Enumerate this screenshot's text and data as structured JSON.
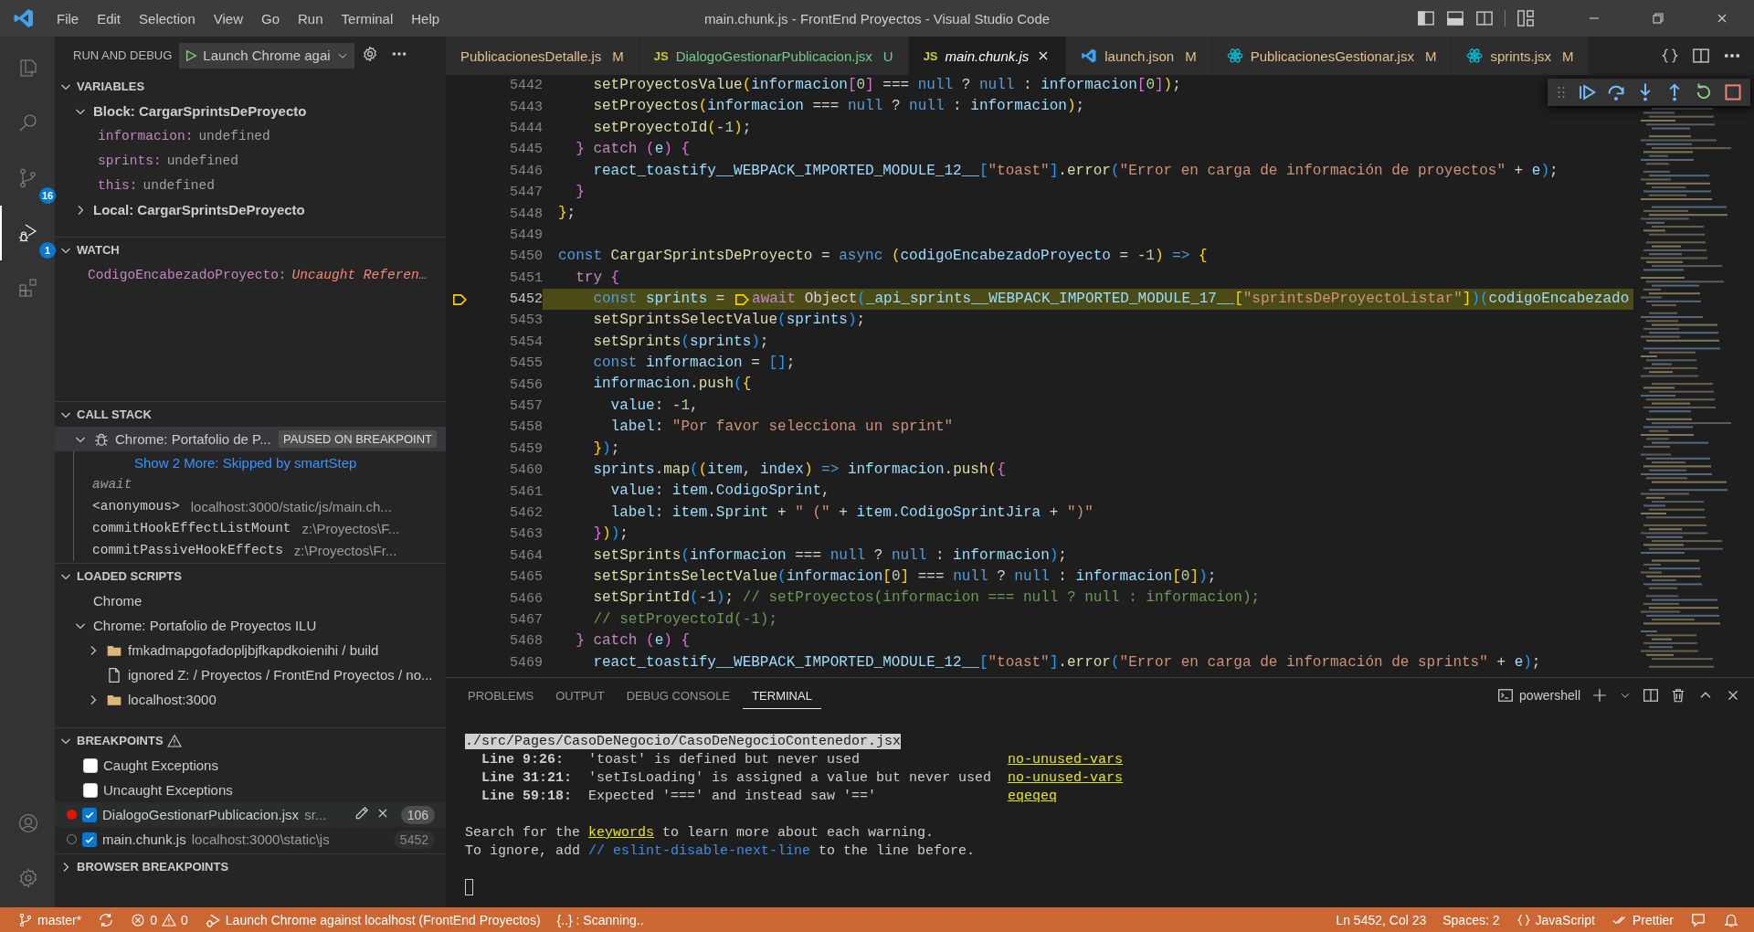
{
  "title_bar": {
    "menu": [
      "File",
      "Edit",
      "Selection",
      "View",
      "Go",
      "Run",
      "Terminal",
      "Help"
    ],
    "title": "main.chunk.js - FrontEnd Proyectos - Visual Studio Code"
  },
  "activity_bar": {
    "items": [
      {
        "kind": "explorer",
        "selected": false
      },
      {
        "kind": "search",
        "selected": false
      },
      {
        "kind": "source-control",
        "selected": false,
        "badge": "16"
      },
      {
        "kind": "run-debug",
        "selected": true,
        "badge": "1"
      },
      {
        "kind": "extensions",
        "selected": false
      }
    ],
    "bottom": [
      {
        "kind": "accounts"
      },
      {
        "kind": "manage"
      }
    ]
  },
  "sidebar": {
    "title": "RUN AND DEBUG",
    "launch_config": "Launch Chrome agai",
    "variables": {
      "title": "VARIABLES",
      "expanded": true,
      "scopes": [
        {
          "label": "Block: CargarSprintsDeProyecto",
          "expanded": true,
          "children": [
            {
              "name": "informacion:",
              "value": "undefined"
            },
            {
              "name": "sprints:",
              "value": "undefined"
            },
            {
              "name": "this:",
              "value": "undefined"
            }
          ]
        },
        {
          "label": "Local: CargarSprintsDeProyecto",
          "expanded": false
        }
      ]
    },
    "watch": {
      "title": "WATCH",
      "expanded": true,
      "items": [
        {
          "expression": "CodigoEncabezadoProyecto:",
          "value": "Uncaught Referen…"
        }
      ]
    },
    "call_stack": {
      "title": "CALL STACK",
      "expanded": true,
      "session": {
        "label": "Chrome: Portafolio de P...",
        "status": "PAUSED ON BREAKPOINT",
        "expanded": true
      },
      "show_more": "Show 2 More: Skipped by smartStep",
      "frames": [
        {
          "kind": "label",
          "name": "await"
        },
        {
          "kind": "frame",
          "name": "<anonymous>",
          "source": "localhost:3000/static/js/main.ch..."
        },
        {
          "kind": "frame",
          "name": "commitHookEffectListMount",
          "source": "z:\\Proyectos\\F..."
        },
        {
          "kind": "frame",
          "name": "commitPassiveHookEffects",
          "source": "z:\\Proyectos\\Fr..."
        }
      ]
    },
    "loaded_scripts": {
      "title": "LOADED SCRIPTS",
      "expanded": true,
      "items": [
        {
          "label": "Chrome"
        },
        {
          "label": "Chrome: Portafolio de Proyectos ILU",
          "expanded": true,
          "children": [
            {
              "kind": "folder",
              "label": "fmkadmapgofadopljbjfkapdkoienihi / build",
              "expanded": false
            },
            {
              "kind": "file",
              "label": "ignored Z: / Proyectos / FrontEnd Proyectos / no..."
            },
            {
              "kind": "folder",
              "label": "localhost:3000",
              "expanded": false
            }
          ]
        }
      ]
    },
    "breakpoints": {
      "title": "BREAKPOINTS",
      "warning": true,
      "expanded": true,
      "items": [
        {
          "kind": "exception",
          "label": "Caught Exceptions",
          "checked": false
        },
        {
          "kind": "exception",
          "label": "Uncaught Exceptions",
          "checked": false
        },
        {
          "kind": "source",
          "label": "DialogoGestionarPublicacion.jsx",
          "path": "sr...",
          "line": "106",
          "checked": true,
          "verified": true,
          "selected": true
        },
        {
          "kind": "source",
          "label": "main.chunk.js",
          "path": "localhost:3000\\static\\js",
          "line": "5452",
          "checked": true,
          "verified": false,
          "selected": false
        }
      ]
    },
    "browser_breakpoints": {
      "title": "BROWSER BREAKPOINTS",
      "expanded": false
    }
  },
  "editor": {
    "tabs": [
      {
        "kind": "plain",
        "label": "PublicacionesDetalle.js",
        "status": "M",
        "selected": false,
        "preview": false
      },
      {
        "kind": "js",
        "badge": "JS",
        "label": "DialogoGestionarPublicacion.jsx",
        "status": "U",
        "selected": false,
        "preview": false
      },
      {
        "kind": "js",
        "badge": "JS",
        "label": "main.chunk.js",
        "selected": true,
        "preview": true
      },
      {
        "kind": "vscode",
        "label": "launch.json",
        "status": "M",
        "selected": false,
        "preview": false
      },
      {
        "kind": "react",
        "label": "PublicacionesGestionar.jsx",
        "status": "M",
        "selected": false,
        "preview": false
      },
      {
        "kind": "react",
        "label": "sprints.jsx",
        "status": "M",
        "selected": false,
        "preview": false
      }
    ],
    "lines": [
      {
        "number": "5442",
        "current": false,
        "tokens": [
          {
            "kind": "fn",
            "text": "    setProyectosValue"
          },
          {
            "kind": "b1",
            "text": "("
          },
          {
            "kind": "var",
            "text": "informacion"
          },
          {
            "kind": "b2",
            "text": "["
          },
          {
            "kind": "num",
            "text": "0"
          },
          {
            "kind": "b2",
            "text": "]"
          },
          {
            "kind": "p",
            "text": " === "
          },
          {
            "kind": "kw",
            "text": "null"
          },
          {
            "kind": "p",
            "text": " ? "
          },
          {
            "kind": "kw",
            "text": "null"
          },
          {
            "kind": "p",
            "text": " : "
          },
          {
            "kind": "var",
            "text": "informacion"
          },
          {
            "kind": "b2",
            "text": "["
          },
          {
            "kind": "num",
            "text": "0"
          },
          {
            "kind": "b2",
            "text": "]"
          },
          {
            "kind": "b1",
            "text": ")"
          },
          {
            "kind": "p",
            "text": ";"
          }
        ]
      },
      {
        "number": "5443",
        "current": false,
        "tokens": [
          {
            "kind": "fn",
            "text": "    setProyectos"
          },
          {
            "kind": "b1",
            "text": "("
          },
          {
            "kind": "var",
            "text": "informacion"
          },
          {
            "kind": "p",
            "text": " === "
          },
          {
            "kind": "kw",
            "text": "null"
          },
          {
            "kind": "p",
            "text": " ? "
          },
          {
            "kind": "kw",
            "text": "null"
          },
          {
            "kind": "p",
            "text": " : "
          },
          {
            "kind": "var",
            "text": "informacion"
          },
          {
            "kind": "b1",
            "text": ")"
          },
          {
            "kind": "p",
            "text": ";"
          }
        ]
      },
      {
        "number": "5444",
        "current": false,
        "tokens": [
          {
            "kind": "fn",
            "text": "    setProyectoId"
          },
          {
            "kind": "b1",
            "text": "("
          },
          {
            "kind": "p",
            "text": "-"
          },
          {
            "kind": "num",
            "text": "1"
          },
          {
            "kind": "b1",
            "text": ")"
          },
          {
            "kind": "p",
            "text": ";"
          }
        ]
      },
      {
        "number": "5445",
        "current": false,
        "tokens": [
          {
            "kind": "b2",
            "text": "  }"
          },
          {
            "kind": "ctl",
            "text": " catch "
          },
          {
            "kind": "b2",
            "text": "("
          },
          {
            "kind": "var",
            "text": "e"
          },
          {
            "kind": "b2",
            "text": ") {"
          }
        ]
      },
      {
        "number": "5446",
        "current": false,
        "tokens": [
          {
            "kind": "var",
            "text": "    react_toastify__WEBPACK_IMPORTED_MODULE_12__"
          },
          {
            "kind": "b3",
            "text": "["
          },
          {
            "kind": "str",
            "text": "\"toast\""
          },
          {
            "kind": "b3",
            "text": "]"
          },
          {
            "kind": "p",
            "text": "."
          },
          {
            "kind": "fn",
            "text": "error"
          },
          {
            "kind": "b3",
            "text": "("
          },
          {
            "kind": "str",
            "text": "\"Error en carga de información de proyectos\""
          },
          {
            "kind": "p",
            "text": " + "
          },
          {
            "kind": "var",
            "text": "e"
          },
          {
            "kind": "b3",
            "text": ")"
          },
          {
            "kind": "p",
            "text": ";"
          }
        ]
      },
      {
        "number": "5447",
        "current": false,
        "tokens": [
          {
            "kind": "b2",
            "text": "  }"
          }
        ]
      },
      {
        "number": "5448",
        "current": false,
        "tokens": [
          {
            "kind": "b1",
            "text": "}"
          },
          {
            "kind": "p",
            "text": ";"
          }
        ]
      },
      {
        "number": "5449",
        "current": false
      },
      {
        "number": "5450",
        "current": false,
        "tokens": [
          {
            "kind": "kw",
            "text": "const "
          },
          {
            "kind": "fn",
            "text": "CargarSprintsDeProyecto"
          },
          {
            "kind": "p",
            "text": " = "
          },
          {
            "kind": "kw",
            "text": "async "
          },
          {
            "kind": "b1",
            "text": "("
          },
          {
            "kind": "var",
            "text": "codigoEncabezadoProyecto"
          },
          {
            "kind": "p",
            "text": " = -"
          },
          {
            "kind": "num",
            "text": "1"
          },
          {
            "kind": "b1",
            "text": ")"
          },
          {
            "kind": "kw",
            "text": " => "
          },
          {
            "kind": "b1",
            "text": "{"
          }
        ]
      },
      {
        "number": "5451",
        "current": false,
        "tokens": [
          {
            "kind": "ctl",
            "text": "  try "
          },
          {
            "kind": "b2",
            "text": "{"
          }
        ]
      },
      {
        "number": "5452",
        "current": true,
        "tokens": [
          {
            "kind": "kw",
            "text": "    const "
          },
          {
            "kind": "var",
            "text": "sprints"
          },
          {
            "kind": "p",
            "text": " = "
          },
          {
            "kind": "inline-breakpoint"
          },
          {
            "kind": "ctl",
            "text": "await "
          },
          {
            "kind": "p",
            "text": "Object"
          },
          {
            "kind": "b3",
            "text": "("
          },
          {
            "kind": "var",
            "text": "_api_sprints__WEBPACK_IMPORTED_MODULE_17__"
          },
          {
            "kind": "b1",
            "text": "["
          },
          {
            "kind": "str",
            "text": "\"sprintsDeProyectoListar\""
          },
          {
            "kind": "b1",
            "text": "]"
          },
          {
            "kind": "b3",
            "text": ")("
          },
          {
            "kind": "var",
            "text": "codigoEncabezado"
          }
        ]
      },
      {
        "number": "5453",
        "current": false,
        "tokens": [
          {
            "kind": "fn",
            "text": "    setSprintsSelectValue"
          },
          {
            "kind": "b3",
            "text": "("
          },
          {
            "kind": "var",
            "text": "sprints"
          },
          {
            "kind": "b3",
            "text": ")"
          },
          {
            "kind": "p",
            "text": ";"
          }
        ]
      },
      {
        "number": "5454",
        "current": false,
        "tokens": [
          {
            "kind": "fn",
            "text": "    setSprints"
          },
          {
            "kind": "b3",
            "text": "("
          },
          {
            "kind": "var",
            "text": "sprints"
          },
          {
            "kind": "b3",
            "text": ")"
          },
          {
            "kind": "p",
            "text": ";"
          }
        ]
      },
      {
        "number": "5455",
        "current": false,
        "tokens": [
          {
            "kind": "kw",
            "text": "    const "
          },
          {
            "kind": "var",
            "text": "informacion"
          },
          {
            "kind": "p",
            "text": " = "
          },
          {
            "kind": "b3",
            "text": "[]"
          },
          {
            "kind": "p",
            "text": ";"
          }
        ]
      },
      {
        "number": "5456",
        "current": false,
        "tokens": [
          {
            "kind": "var",
            "text": "    informacion"
          },
          {
            "kind": "p",
            "text": "."
          },
          {
            "kind": "fn",
            "text": "push"
          },
          {
            "kind": "b3",
            "text": "("
          },
          {
            "kind": "b1",
            "text": "{"
          }
        ]
      },
      {
        "number": "5457",
        "current": false,
        "tokens": [
          {
            "kind": "var",
            "text": "      value"
          },
          {
            "kind": "p",
            "text": ": -"
          },
          {
            "kind": "num",
            "text": "1"
          },
          {
            "kind": "p",
            "text": ","
          }
        ]
      },
      {
        "number": "5458",
        "current": false,
        "tokens": [
          {
            "kind": "var",
            "text": "      label"
          },
          {
            "kind": "p",
            "text": ": "
          },
          {
            "kind": "str",
            "text": "\"Por favor selecciona un sprint\""
          }
        ]
      },
      {
        "number": "5459",
        "current": false,
        "tokens": [
          {
            "kind": "b1",
            "text": "    }"
          },
          {
            "kind": "b3",
            "text": ")"
          },
          {
            "kind": "p",
            "text": ";"
          }
        ]
      },
      {
        "number": "5460",
        "current": false,
        "tokens": [
          {
            "kind": "var",
            "text": "    sprints"
          },
          {
            "kind": "p",
            "text": "."
          },
          {
            "kind": "fn",
            "text": "map"
          },
          {
            "kind": "b3",
            "text": "("
          },
          {
            "kind": "b1",
            "text": "("
          },
          {
            "kind": "var",
            "text": "item"
          },
          {
            "kind": "p",
            "text": ", "
          },
          {
            "kind": "var",
            "text": "index"
          },
          {
            "kind": "b1",
            "text": ")"
          },
          {
            "kind": "kw",
            "text": " => "
          },
          {
            "kind": "var",
            "text": "informacion"
          },
          {
            "kind": "p",
            "text": "."
          },
          {
            "kind": "fn",
            "text": "push"
          },
          {
            "kind": "b1",
            "text": "("
          },
          {
            "kind": "b2",
            "text": "{"
          }
        ]
      },
      {
        "number": "5461",
        "current": false,
        "tokens": [
          {
            "kind": "var",
            "text": "      value"
          },
          {
            "kind": "p",
            "text": ": "
          },
          {
            "kind": "var",
            "text": "item"
          },
          {
            "kind": "p",
            "text": "."
          },
          {
            "kind": "var",
            "text": "CodigoSprint"
          },
          {
            "kind": "p",
            "text": ","
          }
        ]
      },
      {
        "number": "5462",
        "current": false,
        "tokens": [
          {
            "kind": "var",
            "text": "      label"
          },
          {
            "kind": "p",
            "text": ": "
          },
          {
            "kind": "var",
            "text": "item"
          },
          {
            "kind": "p",
            "text": "."
          },
          {
            "kind": "var",
            "text": "Sprint"
          },
          {
            "kind": "p",
            "text": " + "
          },
          {
            "kind": "str",
            "text": "\" (\""
          },
          {
            "kind": "p",
            "text": " + "
          },
          {
            "kind": "var",
            "text": "item"
          },
          {
            "kind": "p",
            "text": "."
          },
          {
            "kind": "var",
            "text": "CodigoSprintJira"
          },
          {
            "kind": "p",
            "text": " + "
          },
          {
            "kind": "str",
            "text": "\")\""
          }
        ]
      },
      {
        "number": "5463",
        "current": false,
        "tokens": [
          {
            "kind": "b2",
            "text": "    }"
          },
          {
            "kind": "b1",
            "text": ")"
          },
          {
            "kind": "b3",
            "text": ")"
          },
          {
            "kind": "p",
            "text": ";"
          }
        ]
      },
      {
        "number": "5464",
        "current": false,
        "tokens": [
          {
            "kind": "fn",
            "text": "    setSprints"
          },
          {
            "kind": "b3",
            "text": "("
          },
          {
            "kind": "var",
            "text": "informacion"
          },
          {
            "kind": "p",
            "text": " === "
          },
          {
            "kind": "kw",
            "text": "null"
          },
          {
            "kind": "p",
            "text": " ? "
          },
          {
            "kind": "kw",
            "text": "null"
          },
          {
            "kind": "p",
            "text": " : "
          },
          {
            "kind": "var",
            "text": "informacion"
          },
          {
            "kind": "b3",
            "text": ")"
          },
          {
            "kind": "p",
            "text": ";"
          }
        ]
      },
      {
        "number": "5465",
        "current": false,
        "tokens": [
          {
            "kind": "fn",
            "text": "    setSprintsSelectValue"
          },
          {
            "kind": "b3",
            "text": "("
          },
          {
            "kind": "var",
            "text": "informacion"
          },
          {
            "kind": "b1",
            "text": "["
          },
          {
            "kind": "num",
            "text": "0"
          },
          {
            "kind": "b1",
            "text": "]"
          },
          {
            "kind": "p",
            "text": " === "
          },
          {
            "kind": "kw",
            "text": "null"
          },
          {
            "kind": "p",
            "text": " ? "
          },
          {
            "kind": "kw",
            "text": "null"
          },
          {
            "kind": "p",
            "text": " : "
          },
          {
            "kind": "var",
            "text": "informacion"
          },
          {
            "kind": "b1",
            "text": "["
          },
          {
            "kind": "num",
            "text": "0"
          },
          {
            "kind": "b1",
            "text": "]"
          },
          {
            "kind": "b3",
            "text": ")"
          },
          {
            "kind": "p",
            "text": ";"
          }
        ]
      },
      {
        "number": "5466",
        "current": false,
        "tokens": [
          {
            "kind": "fn",
            "text": "    setSprintId"
          },
          {
            "kind": "b3",
            "text": "("
          },
          {
            "kind": "p",
            "text": "-"
          },
          {
            "kind": "num",
            "text": "1"
          },
          {
            "kind": "b3",
            "text": ")"
          },
          {
            "kind": "p",
            "text": "; "
          },
          {
            "kind": "com",
            "text": "// setProyectos(informacion === null ? null : informacion);"
          }
        ]
      },
      {
        "number": "5467",
        "current": false,
        "tokens": [
          {
            "kind": "com",
            "text": "    // setProyectoId(-1);"
          }
        ]
      },
      {
        "number": "5468",
        "current": false,
        "tokens": [
          {
            "kind": "b2",
            "text": "  }"
          },
          {
            "kind": "ctl",
            "text": " catch "
          },
          {
            "kind": "b2",
            "text": "("
          },
          {
            "kind": "var",
            "text": "e"
          },
          {
            "kind": "b2",
            "text": ") {"
          }
        ]
      },
      {
        "number": "5469",
        "current": false,
        "tokens": [
          {
            "kind": "var",
            "text": "    react_toastify__WEBPACK_IMPORTED_MODULE_12__"
          },
          {
            "kind": "b3",
            "text": "["
          },
          {
            "kind": "str",
            "text": "\"toast\""
          },
          {
            "kind": "b3",
            "text": "]"
          },
          {
            "kind": "p",
            "text": "."
          },
          {
            "kind": "fn",
            "text": "error"
          },
          {
            "kind": "b3",
            "text": "("
          },
          {
            "kind": "str",
            "text": "\"Error en carga de información de sprints\""
          },
          {
            "kind": "p",
            "text": " + "
          },
          {
            "kind": "var",
            "text": "e"
          },
          {
            "kind": "b3",
            "text": ")"
          },
          {
            "kind": "p",
            "text": ";"
          }
        ]
      }
    ]
  },
  "panel": {
    "tabs": [
      {
        "label": "PROBLEMS",
        "selected": false
      },
      {
        "label": "OUTPUT",
        "selected": false
      },
      {
        "label": "DEBUG CONSOLE",
        "selected": false
      },
      {
        "label": "TERMINAL",
        "selected": true
      }
    ],
    "shell": "powershell",
    "terminal": {
      "file": "./src/Pages/CasoDeNegocio/CasoDeNegocioContenedor.jsx",
      "warnings": [
        {
          "location": "Line 9:26:",
          "message": "'toast' is defined but never used",
          "rule": "no-unused-vars"
        },
        {
          "location": "Line 31:21:",
          "message": "'setIsLoading' is assigned a value but never used",
          "rule": "no-unused-vars"
        },
        {
          "location": "Line 59:18:",
          "message": "Expected '===' and instead saw '=='",
          "rule": "eqeqeq"
        }
      ],
      "notes": [
        {
          "segments": [
            {
              "kind": "plain",
              "text": "Search for the "
            },
            {
              "kind": "link",
              "text": "keywords"
            },
            {
              "kind": "plain",
              "text": " to learn more about each warning."
            }
          ]
        },
        {
          "segments": [
            {
              "kind": "plain",
              "text": "To ignore, add "
            },
            {
              "kind": "code",
              "text": "// eslint-disable-next-line"
            },
            {
              "kind": "plain",
              "text": " to the line before."
            }
          ]
        }
      ]
    }
  },
  "status_bar": {
    "branch": "master*",
    "errors": "0",
    "warnings": "0",
    "debug_target": "Launch Chrome against localhost (FrontEnd Proyectos)",
    "task": "{..} : Scanning..",
    "position": "Ln 5452, Col 23",
    "indentation": "Spaces: 2",
    "language": "JavaScript",
    "formatter": "Prettier"
  }
}
